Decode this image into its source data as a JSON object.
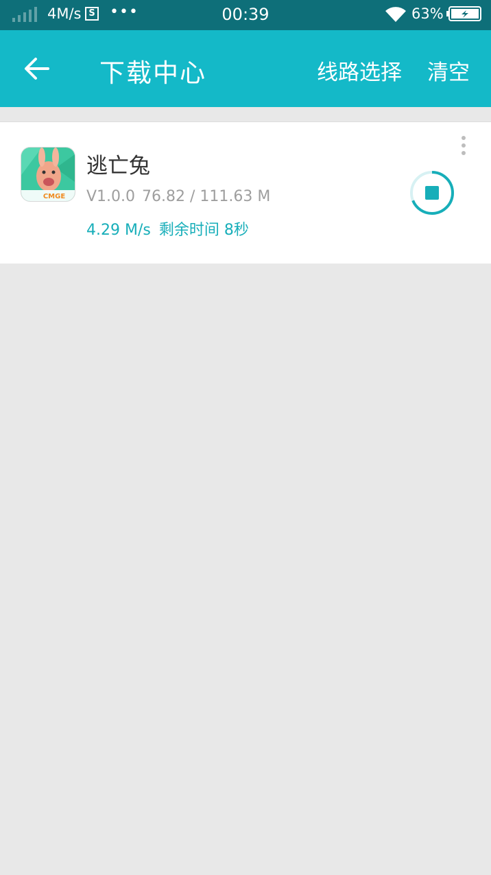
{
  "status_bar": {
    "net_speed": "4M/s",
    "time": "00:39",
    "battery_percent": "63%",
    "icons": [
      "signal-icon",
      "screenshot-s-icon",
      "more-dots-icon",
      "wifi-icon",
      "battery-charging-icon"
    ]
  },
  "header": {
    "title": "下载中心",
    "route_select": "线路选择",
    "clear": "清空",
    "back_icon": "arrow-left-icon",
    "color": "#14b9c8"
  },
  "downloads": [
    {
      "name": "逃亡兔",
      "version": "V1.0.0",
      "size": "76.82 / 111.63 M",
      "speed": "4.29 M/s",
      "remaining": "剩余时间 8秒",
      "icon_brand": "CMGE",
      "progress_fraction": 0.688
    }
  ],
  "colors": {
    "accent": "#14b9c8",
    "status_bar": "#0e6f79",
    "background": "#e8e8e8",
    "speed_text": "#17aeb9"
  }
}
